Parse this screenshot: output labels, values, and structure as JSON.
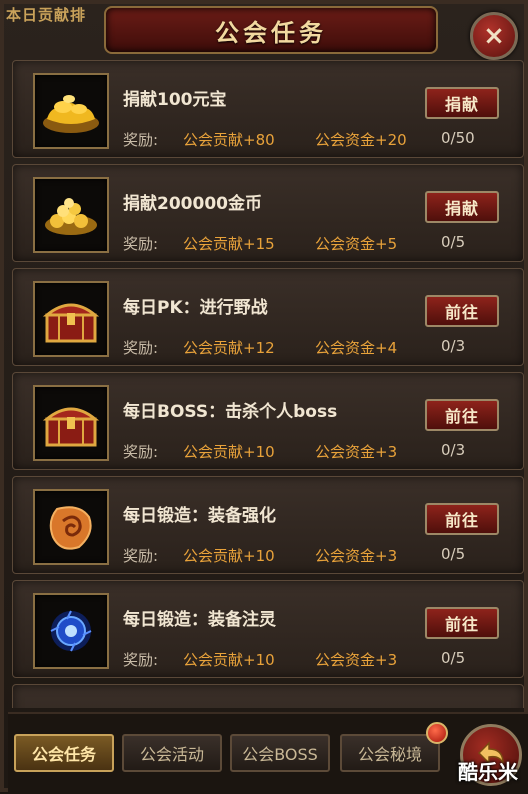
{
  "background_text": "本日贡献排",
  "title": "公会任务",
  "close_label": "×",
  "reward_prefix": "奖励:",
  "tasks": [
    {
      "name": "捐献100元宝",
      "reward_contribution": "公会贡献+80",
      "reward_funds": "公会资金+20",
      "progress": "0/50",
      "button": "捐献",
      "icon": "gold-ingot-icon"
    },
    {
      "name": "捐献200000金币",
      "reward_contribution": "公会贡献+15",
      "reward_funds": "公会资金+5",
      "progress": "0/5",
      "button": "捐献",
      "icon": "gold-coins-icon"
    },
    {
      "name": "每日PK：进行野战",
      "reward_contribution": "公会贡献+12",
      "reward_funds": "公会资金+4",
      "progress": "0/3",
      "button": "前往",
      "icon": "treasure-chest-icon"
    },
    {
      "name": "每日BOSS：击杀个人boss",
      "reward_contribution": "公会贡献+10",
      "reward_funds": "公会资金+3",
      "progress": "0/3",
      "button": "前往",
      "icon": "treasure-chest-icon"
    },
    {
      "name": "每日锻造：装备强化",
      "reward_contribution": "公会贡献+10",
      "reward_funds": "公会资金+3",
      "progress": "0/5",
      "button": "前往",
      "icon": "enhance-stone-icon"
    },
    {
      "name": "每日锻造：装备注灵",
      "reward_contribution": "公会贡献+10",
      "reward_funds": "公会资金+3",
      "progress": "0/5",
      "button": "前往",
      "icon": "spirit-orb-icon"
    }
  ],
  "tabs": [
    {
      "label": "公会任务",
      "active": true
    },
    {
      "label": "公会活动",
      "active": false
    },
    {
      "label": "公会BOSS",
      "active": false
    },
    {
      "label": "公会秘境",
      "active": false
    }
  ],
  "watermark": "酷乐米"
}
